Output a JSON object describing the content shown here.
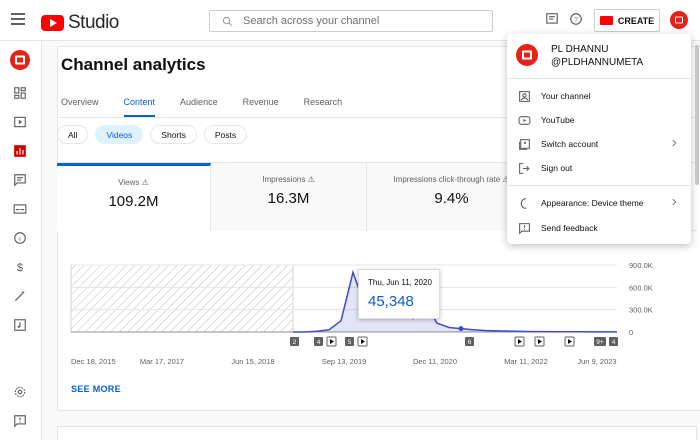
{
  "header": {
    "logo_text": "Studio",
    "search_placeholder": "Search across your channel",
    "create_label": "CREATE"
  },
  "sidebar": {
    "items": [
      "dashboard-icon",
      "content-icon",
      "analytics-icon",
      "comments-icon",
      "subtitles-icon",
      "copyright-icon",
      "earn-icon",
      "customization-icon",
      "audio-library-icon",
      "settings-icon",
      "feedback-icon"
    ]
  },
  "page": {
    "title": "Channel analytics",
    "tabs": [
      {
        "label": "Overview",
        "active": false
      },
      {
        "label": "Content",
        "active": true
      },
      {
        "label": "Audience",
        "active": false
      },
      {
        "label": "Revenue",
        "active": false
      },
      {
        "label": "Research",
        "active": false
      }
    ],
    "chips": [
      {
        "label": "All",
        "active": false
      },
      {
        "label": "Videos",
        "active": true
      },
      {
        "label": "Shorts",
        "active": false
      },
      {
        "label": "Posts",
        "active": false
      }
    ],
    "metrics": [
      {
        "label": "Views",
        "value": "109.2M"
      },
      {
        "label": "Impressions",
        "value": "16.3M"
      },
      {
        "label": "Impressions click-through rate",
        "value": "9.4%"
      }
    ],
    "see_more": "SEE MORE"
  },
  "chart_data": {
    "type": "line",
    "x_ticks": [
      "Dec 18, 2015",
      "Mar 17, 2017",
      "Jun 15, 2018",
      "Sep 13, 2019",
      "Dec 11, 2020",
      "Mar 11, 2022",
      "Jun 9, 2023"
    ],
    "y_ticks": [
      "900.0K",
      "600.0K",
      "300.0K",
      "0"
    ],
    "ylim": [
      0,
      900000
    ],
    "series": [
      {
        "values": [
          0,
          0,
          10000,
          30000,
          150000,
          800000,
          350000,
          650000,
          250000,
          500000,
          180000,
          400000,
          120000,
          60000,
          45348,
          30000,
          20000,
          15000,
          12000,
          8000,
          6000,
          5000,
          4000,
          3000,
          3000,
          2000,
          2000,
          2000
        ]
      }
    ],
    "markers": [
      "2",
      "4",
      "5",
      "6",
      "9+",
      "4"
    ],
    "tooltip": {
      "date": "Thu, Jun 11, 2020",
      "value": "45,348"
    },
    "color": "#3f4bc9"
  },
  "account_menu": {
    "name": "PL DHANNU",
    "handle": "@PLDHANNUMETA",
    "items": [
      {
        "label": "Your channel",
        "icon": "person-icon",
        "chevron": false
      },
      {
        "label": "YouTube",
        "icon": "youtube-icon",
        "chevron": false
      },
      {
        "label": "Switch account",
        "icon": "switch-account-icon",
        "chevron": true
      },
      {
        "label": "Sign out",
        "icon": "sign-out-icon",
        "chevron": false
      },
      {
        "label": "Appearance: Device theme",
        "icon": "moon-icon",
        "chevron": true
      },
      {
        "label": "Send feedback",
        "icon": "feedback-icon",
        "chevron": false
      }
    ]
  },
  "colors": {
    "brand": "#ff0000",
    "accent": "#065fd4",
    "line": "#3f4bc9"
  }
}
